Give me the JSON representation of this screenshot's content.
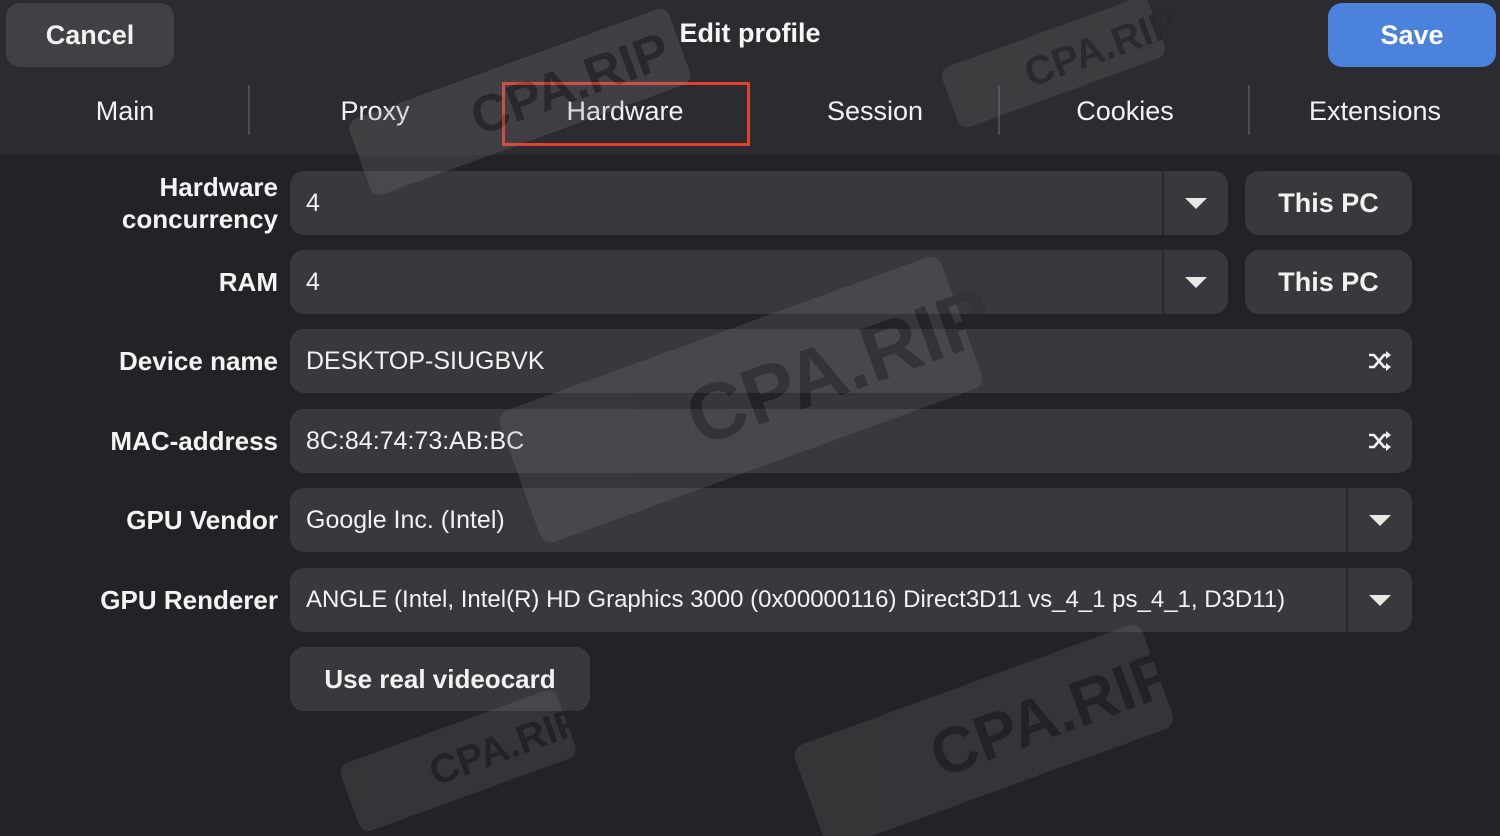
{
  "header": {
    "cancel": "Cancel",
    "title": "Edit profile",
    "save": "Save"
  },
  "tabs": [
    {
      "label": "Main"
    },
    {
      "label": "Proxy"
    },
    {
      "label": "Hardware",
      "active": true
    },
    {
      "label": "Session"
    },
    {
      "label": "Cookies"
    },
    {
      "label": "Extensions"
    }
  ],
  "fields": {
    "hardware_concurrency": {
      "label_line1": "Hardware",
      "label_line2": "concurrency",
      "value": "4",
      "button": "This PC"
    },
    "ram": {
      "label": "RAM",
      "value": "4",
      "button": "This PC"
    },
    "device_name": {
      "label": "Device name",
      "value": "DESKTOP-SIUGBVK",
      "icon": "shuffle-icon"
    },
    "mac_address": {
      "label": "MAC-address",
      "value": "8C:84:74:73:AB:BC",
      "icon": "shuffle-icon"
    },
    "gpu_vendor": {
      "label": "GPU Vendor",
      "value": "Google Inc. (Intel)"
    },
    "gpu_renderer": {
      "label": "GPU Renderer",
      "value": "ANGLE (Intel, Intel(R) HD Graphics 3000 (0x00000116) Direct3D11 vs_4_1 ps_4_1, D3D11)"
    }
  },
  "use_real_videocard": "Use real videocard",
  "watermark": "CPA.RIP",
  "colors": {
    "accent": "#4a82dc",
    "highlight": "#e0412f",
    "background": "#232327",
    "field": "#38383d"
  }
}
